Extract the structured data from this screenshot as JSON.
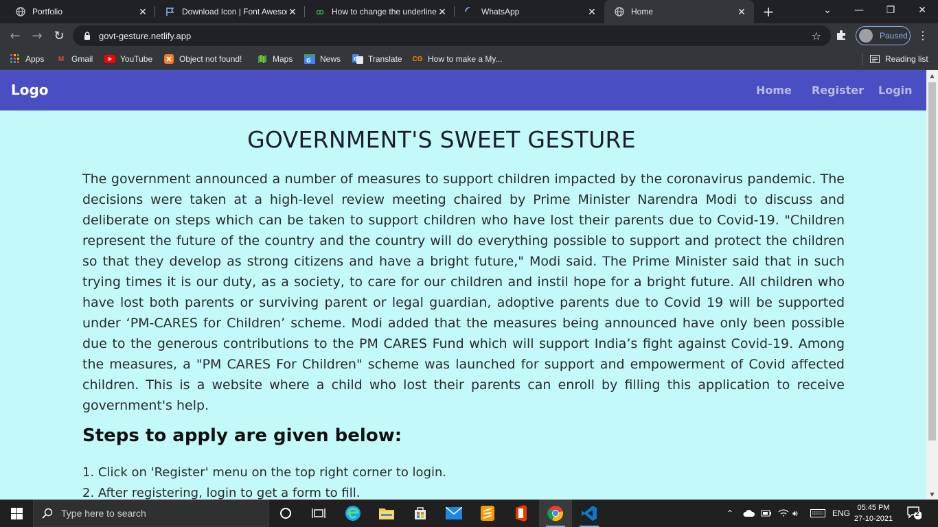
{
  "browser": {
    "tabs": [
      {
        "title": "Portfolio",
        "icon": "globe-icon",
        "active": false
      },
      {
        "title": "Download Icon | Font Awesome",
        "icon": "flag-icon",
        "active": false
      },
      {
        "title": "How to change the underline",
        "icon": "link-icon",
        "active": false
      },
      {
        "title": "WhatsApp",
        "icon": "loading-spinner-icon",
        "active": false
      },
      {
        "title": "Home",
        "icon": "globe-icon",
        "active": true
      }
    ],
    "url": "govt-gesture.netlify.app",
    "profile_status": "Paused",
    "bookmarks": [
      {
        "label": "Apps",
        "icon": "apps-grid-icon",
        "color": "#ea4335"
      },
      {
        "label": "Gmail",
        "icon": "gmail-icon",
        "color": "#ea4335"
      },
      {
        "label": "YouTube",
        "icon": "youtube-icon",
        "color": "#ff0000"
      },
      {
        "label": "Object not found!",
        "icon": "xampp-icon",
        "color": "#fb7a24"
      },
      {
        "label": "Maps",
        "icon": "maps-icon",
        "color": "#34a853"
      },
      {
        "label": "News",
        "icon": "news-icon",
        "color": "#4285f4"
      },
      {
        "label": "Translate",
        "icon": "translate-icon",
        "color": "#4285f4"
      },
      {
        "label": "How to make a My...",
        "icon": "cg-icon",
        "color": "#f28b00"
      }
    ],
    "reading_list": "Reading list"
  },
  "site": {
    "nav": {
      "logo": "Logo",
      "links": [
        "Home",
        "Register",
        "Login"
      ]
    },
    "heading": "GOVERNMENT'S SWEET GESTURE",
    "paragraph": "The government announced a number of measures to support children impacted by the coronavirus pandemic. The decisions were taken at a high-level review meeting chaired by Prime Minister Narendra Modi to discuss and deliberate on steps which can be taken to support children who have lost their parents due to Covid-19. \"Children represent the future of the country and the country will do everything possible to support and protect the children so that they develop as strong citizens and have a bright future,\" Modi said. The Prime Minister said that in such trying times it is our duty, as a society, to care for our children and instil hope for a bright future. All children who have lost both parents or surviving parent or legal guardian, adoptive parents due to Covid 19 will be supported under ‘PM-CARES for Children’ scheme. Modi added that the measures being announced have only been possible due to the generous contributions to the PM CARES Fund which will support India’s fight against Covid-19. Among the measures, a \"PM CARES For Children\" scheme was launched for support and empowerment of Covid affected children. This is a website where a child who lost their parents can enroll by filling this application to receive government's help.",
    "steps_heading": "Steps to apply are given below:",
    "steps": [
      "1. Click on 'Register' menu on the top right corner to login.",
      "2. After registering, login to get a form to fill."
    ]
  },
  "taskbar": {
    "search_placeholder": "Type here to search",
    "language": "ENG",
    "time": "05:45 PM",
    "date": "27-10-2021",
    "notification_count": "2"
  },
  "colors": {
    "nav_bg": "#4a4ec3",
    "page_bg": "#c4f9f9",
    "browser_dark": "#202124"
  }
}
